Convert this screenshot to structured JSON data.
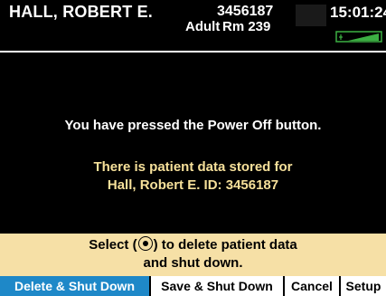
{
  "header": {
    "patient_name": "HALL, ROBERT E.",
    "patient_id": "3456187",
    "patient_type": "Adult",
    "room": "Rm 239",
    "time": "15:01:24",
    "battery_icon": "battery-charging-icon",
    "battery_color": "#3cb043"
  },
  "message": {
    "main": "You have pressed the Power Off button.",
    "data_line1": "There is patient data stored for",
    "data_line2": "Hall, Robert E. ID: 3456187"
  },
  "prompt": {
    "select_prefix": "Select (",
    "select_icon": "select-knob-icon",
    "select_suffix": ") to delete patient data",
    "line2": "and shut down."
  },
  "softkeys": {
    "delete": "Delete & Shut Down",
    "save": "Save & Shut Down",
    "cancel": "Cancel",
    "setup": "Setup"
  },
  "colors": {
    "background": "#000000",
    "prompt_band": "#f6e0a6",
    "highlight_text": "#f6e09a",
    "active_softkey": "#1e88c8"
  }
}
